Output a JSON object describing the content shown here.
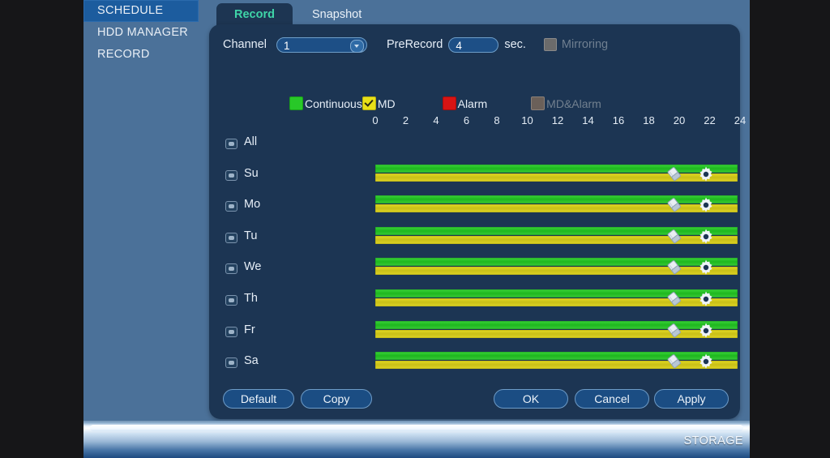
{
  "sidebar": {
    "items": [
      {
        "label": "SCHEDULE",
        "active": true
      },
      {
        "label": "HDD MANAGER",
        "active": false
      },
      {
        "label": "RECORD",
        "active": false
      }
    ]
  },
  "tabs": [
    {
      "label": "Record",
      "active": true
    },
    {
      "label": "Snapshot",
      "active": false
    }
  ],
  "toolbar": {
    "channel_label": "Channel",
    "channel_value": "1",
    "prerecord_label": "PreRecord",
    "prerecord_value": "4",
    "sec_label": "sec.",
    "mirroring_label": "Mirroring",
    "mirroring_checked": false,
    "mirroring_enabled": false
  },
  "legend": [
    {
      "name": "continuous",
      "label": "Continuous",
      "color": "#28c828",
      "checked": false,
      "enabled": true
    },
    {
      "name": "md",
      "label": "MD",
      "color": "#e8e018",
      "checked": true,
      "enabled": true
    },
    {
      "name": "alarm",
      "label": "Alarm",
      "color": "#d81414",
      "checked": false,
      "enabled": true
    },
    {
      "name": "md-alarm",
      "label": "MD&Alarm",
      "color": "#6b6059",
      "checked": false,
      "enabled": false
    }
  ],
  "ruler": {
    "ticks": [
      "0",
      "2",
      "4",
      "6",
      "8",
      "10",
      "12",
      "14",
      "16",
      "18",
      "20",
      "22",
      "24"
    ],
    "min": 0,
    "max": 24
  },
  "schedule": {
    "rows": [
      {
        "day": "All",
        "checked": false,
        "has_bars": false,
        "periods": []
      },
      {
        "day": "Su",
        "checked": false,
        "has_bars": true,
        "periods": [
          {
            "type": "Continuous",
            "color": "#28c828",
            "start": 0,
            "end": 24
          },
          {
            "type": "MD",
            "color": "#e8e018",
            "start": 0,
            "end": 24
          }
        ]
      },
      {
        "day": "Mo",
        "checked": false,
        "has_bars": true,
        "periods": [
          {
            "type": "Continuous",
            "color": "#28c828",
            "start": 0,
            "end": 24
          },
          {
            "type": "MD",
            "color": "#e8e018",
            "start": 0,
            "end": 24
          }
        ]
      },
      {
        "day": "Tu",
        "checked": false,
        "has_bars": true,
        "periods": [
          {
            "type": "Continuous",
            "color": "#28c828",
            "start": 0,
            "end": 24
          },
          {
            "type": "MD",
            "color": "#e8e018",
            "start": 0,
            "end": 24
          }
        ]
      },
      {
        "day": "We",
        "checked": false,
        "has_bars": true,
        "periods": [
          {
            "type": "Continuous",
            "color": "#28c828",
            "start": 0,
            "end": 24
          },
          {
            "type": "MD",
            "color": "#e8e018",
            "start": 0,
            "end": 24
          }
        ]
      },
      {
        "day": "Th",
        "checked": false,
        "has_bars": true,
        "periods": [
          {
            "type": "Continuous",
            "color": "#28c828",
            "start": 0,
            "end": 24
          },
          {
            "type": "MD",
            "color": "#e8e018",
            "start": 0,
            "end": 24
          }
        ]
      },
      {
        "day": "Fr",
        "checked": false,
        "has_bars": true,
        "periods": [
          {
            "type": "Continuous",
            "color": "#28c828",
            "start": 0,
            "end": 24
          },
          {
            "type": "MD",
            "color": "#e8e018",
            "start": 0,
            "end": 24
          }
        ]
      },
      {
        "day": "Sa",
        "checked": false,
        "has_bars": true,
        "periods": [
          {
            "type": "Continuous",
            "color": "#28c828",
            "start": 0,
            "end": 24
          },
          {
            "type": "MD",
            "color": "#e8e018",
            "start": 0,
            "end": 24
          }
        ]
      }
    ],
    "row_icons": {
      "eraser": "eraser-icon",
      "settings": "gear-icon"
    }
  },
  "buttons": {
    "default": "Default",
    "copy": "Copy",
    "ok": "OK",
    "cancel": "Cancel",
    "apply": "Apply"
  },
  "statusbar": {
    "text": "STORAGE"
  },
  "colors": {
    "accent": "#3fd5a8",
    "panel": "#1c3553",
    "app_bg": "#4b7199",
    "sidebar_active": "#1c5c9e"
  }
}
